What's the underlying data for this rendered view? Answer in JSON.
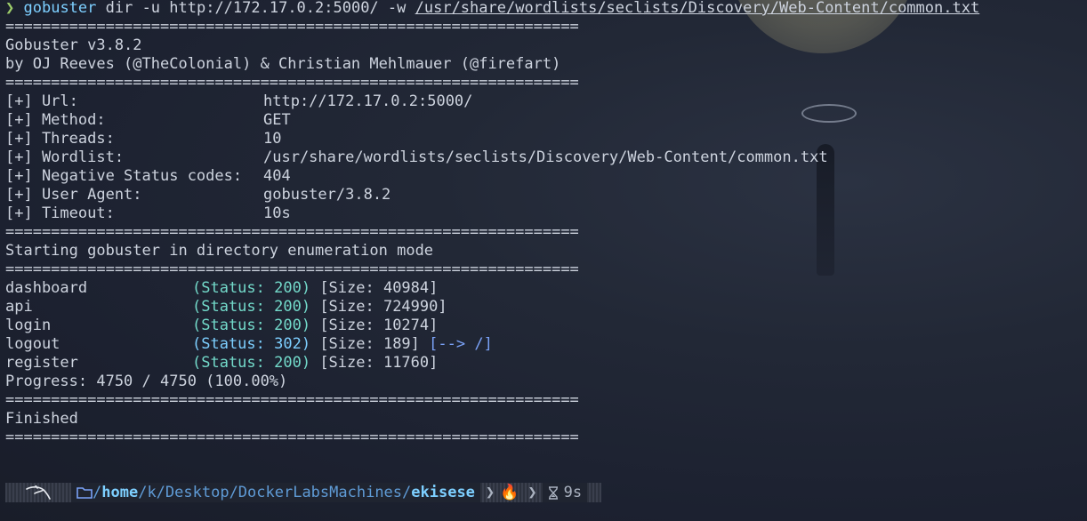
{
  "command": {
    "chevron": "❯",
    "program": "gobuster",
    "args": " dir -u http://172.17.0.2:5000/ -w ",
    "wordlist_path": "/usr/share/wordlists/seclists/Discovery/Web-Content/common.txt"
  },
  "separator": "===============================================================",
  "banner": {
    "version": "Gobuster v3.8.2",
    "authors": "by OJ Reeves (@TheColonial) & Christian Mehlmauer (@firefart)"
  },
  "config": [
    {
      "label": "[+] Url:",
      "value": "http://172.17.0.2:5000/"
    },
    {
      "label": "[+] Method:",
      "value": "GET"
    },
    {
      "label": "[+] Threads:",
      "value": "10"
    },
    {
      "label": "[+] Wordlist:",
      "value": "/usr/share/wordlists/seclists/Discovery/Web-Content/common.txt"
    },
    {
      "label": "[+] Negative Status codes:",
      "value": "404"
    },
    {
      "label": "[+] User Agent:",
      "value": "gobuster/3.8.2"
    },
    {
      "label": "[+] Timeout:",
      "value": "10s"
    }
  ],
  "mode_message": "Starting gobuster in directory enumeration mode",
  "results": [
    {
      "path": "dashboard",
      "status": "(Status: 200)",
      "size": "[Size: 40984]",
      "redirect": ""
    },
    {
      "path": "api",
      "status": "(Status: 200)",
      "size": "[Size: 724990]",
      "redirect": ""
    },
    {
      "path": "login",
      "status": "(Status: 200)",
      "size": "[Size: 10274]",
      "redirect": ""
    },
    {
      "path": "logout",
      "status": "(Status: 302)",
      "size": "[Size: 189]",
      "redirect": "[--> /]"
    },
    {
      "path": "register",
      "status": "(Status: 200)",
      "size": "[Size: 11760]",
      "redirect": ""
    }
  ],
  "progress": "Progress: 4750 / 4750 (100.00%)",
  "finished": "Finished",
  "prompt": {
    "os_icon": "kali-dragon-icon",
    "dir_slash": "/",
    "dir_home": "home",
    "dir_user": "/k/",
    "dir_middle": "Desktop/DockerLabsMachines/",
    "dir_current": "ekisese",
    "git_icon": "🔥",
    "duration": "9s"
  }
}
